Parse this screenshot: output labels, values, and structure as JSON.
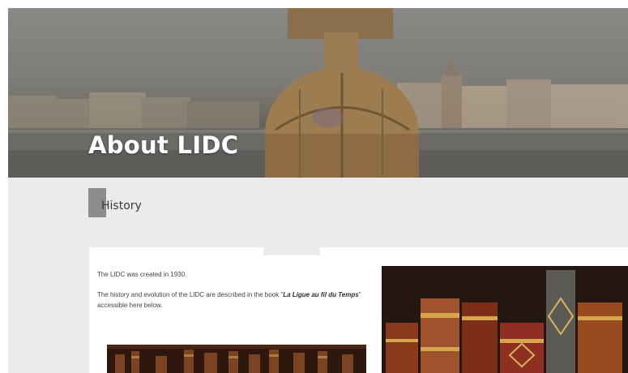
{
  "hero": {
    "title": "About LIDC"
  },
  "section": {
    "heading": "History"
  },
  "content": {
    "paragraph_1": "The LIDC was created in 1930.",
    "paragraph_2_prefix": "The history and evolution of the LIDC are described in the book \"",
    "book_title": "La Ligue au fil du Temps",
    "paragraph_2_suffix": "\" accessible here below."
  }
}
